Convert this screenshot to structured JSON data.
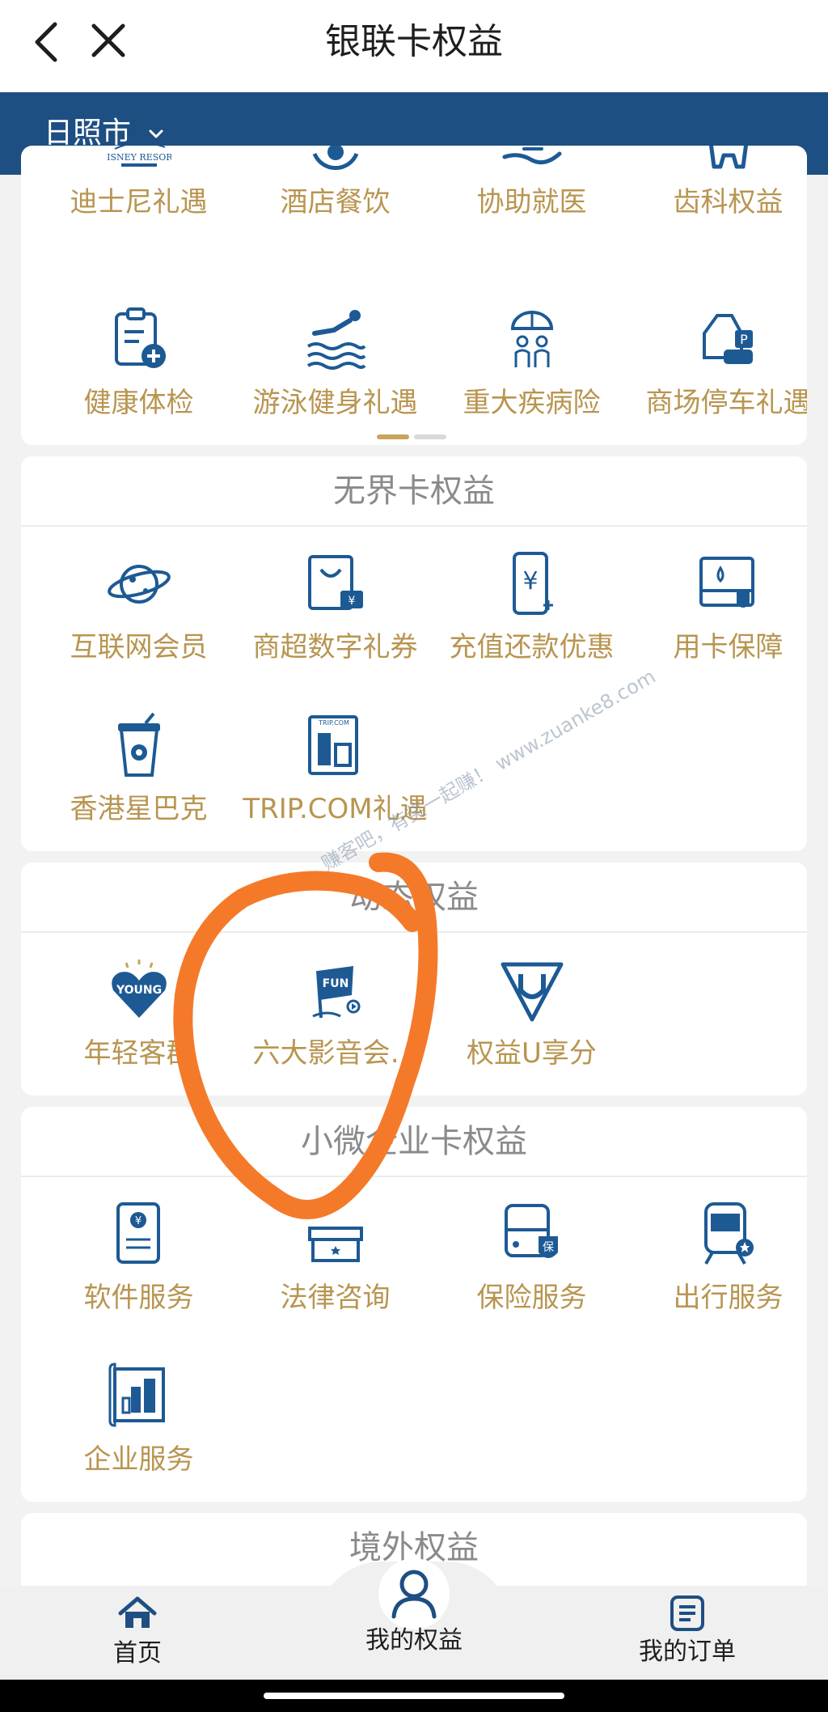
{
  "header": {
    "title": "银联卡权益"
  },
  "location": {
    "city": "日照市"
  },
  "section1": {
    "items": [
      {
        "label": "迪士尼礼遇",
        "icon": "disney-logo-icon"
      },
      {
        "label": "酒店餐饮",
        "icon": "dining-icon"
      },
      {
        "label": "协助就医",
        "icon": "hand-care-icon"
      },
      {
        "label": "齿科权益",
        "icon": "tooth-icon"
      },
      {
        "label": "健康体检",
        "icon": "health-check-icon"
      },
      {
        "label": "游泳健身礼遇",
        "icon": "swimming-icon"
      },
      {
        "label": "重大疾病险",
        "icon": "umbrella-family-icon"
      },
      {
        "label": "商场停车礼遇",
        "icon": "parking-icon"
      }
    ],
    "disney_logo_text": "DISNEY RESORT"
  },
  "section2": {
    "title": "无界卡权益",
    "items": [
      {
        "label": "互联网会员",
        "icon": "planet-icon"
      },
      {
        "label": "商超数字礼券",
        "icon": "shopping-bag-coupon-icon"
      },
      {
        "label": "充值还款优惠",
        "icon": "phone-yuan-icon"
      },
      {
        "label": "用卡保障",
        "icon": "card-shield-icon"
      },
      {
        "label": "香港星巴克",
        "icon": "coffee-cup-icon"
      },
      {
        "label": "TRIP.COM礼遇",
        "icon": "trip-building-icon"
      }
    ],
    "trip_icon_text": "TRIP.COM"
  },
  "section3": {
    "title": "动态权益",
    "items": [
      {
        "label": "年轻客群",
        "icon": "young-heart-icon",
        "badge": "YOUNG"
      },
      {
        "label": "六大影音会…",
        "icon": "fun-flag-icon",
        "badge": "FUN"
      },
      {
        "label": "权益U享分",
        "icon": "u-shield-icon"
      }
    ]
  },
  "section4": {
    "title": "小微企业卡权益",
    "items": [
      {
        "label": "软件服务",
        "icon": "tablet-yuan-icon"
      },
      {
        "label": "法律咨询",
        "icon": "legal-box-icon"
      },
      {
        "label": "保险服务",
        "icon": "bus-insurance-icon"
      },
      {
        "label": "出行服务",
        "icon": "train-icon"
      },
      {
        "label": "企业服务",
        "icon": "blueprint-building-icon"
      }
    ],
    "insurance_glyph": "保"
  },
  "section5": {
    "title": "境外权益"
  },
  "nav": {
    "home": "首页",
    "benefits": "我的权益",
    "orders": "我的订单"
  },
  "watermark": {
    "text": "赚客吧，有奖一起赚！ www.zuanke8.com"
  },
  "colors": {
    "brand_blue": "#1e4f82",
    "label_gold": "#b89550",
    "icon_blue": "#1d5a94",
    "annotation_orange": "#f47a2a"
  }
}
